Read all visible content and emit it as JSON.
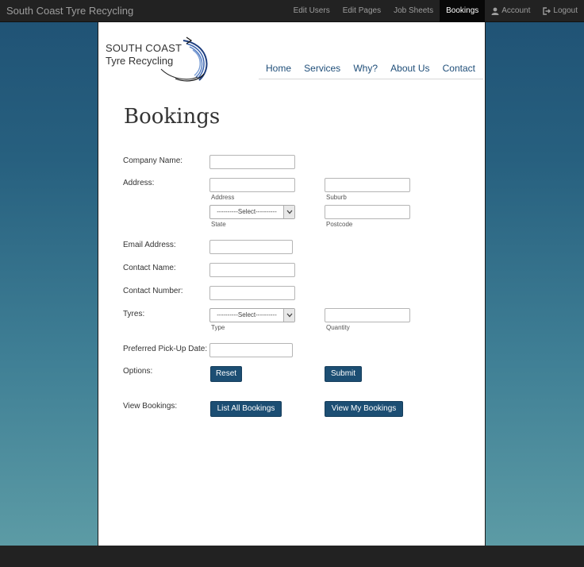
{
  "topbar": {
    "brand": "South Coast Tyre Recycling",
    "links": {
      "edit_users": "Edit Users",
      "edit_pages": "Edit Pages",
      "job_sheets": "Job Sheets",
      "bookings": "Bookings",
      "account": "Account",
      "logout": "Logout"
    },
    "active": "Bookings"
  },
  "logo": {
    "line1": "SOUTH COAST",
    "line2": "Tyre Recycling"
  },
  "nav": {
    "home": "Home",
    "services": "Services",
    "why": "Why?",
    "about": "About Us",
    "contact": "Contact"
  },
  "page": {
    "title": "Bookings"
  },
  "form": {
    "company_name_label": "Company Name:",
    "address_label": "Address:",
    "address_sub": "Address",
    "suburb_sub": "Suburb",
    "state_select": "----------Select----------",
    "state_sub": "State",
    "postcode_sub": "Postcode",
    "email_label": "Email Address:",
    "contact_name_label": "Contact Name:",
    "contact_number_label": "Contact Number:",
    "tyres_label": "Tyres:",
    "tyre_type_select": "----------Select----------",
    "type_sub": "Type",
    "quantity_sub": "Quantity",
    "pickup_date_label": "Preferred Pick-Up Date:",
    "options_label": "Options:",
    "reset_button": "Reset",
    "submit_button": "Submit",
    "view_bookings_label": "View Bookings:",
    "list_all_button": "List All Bookings",
    "view_my_button": "View My Bookings"
  },
  "colors": {
    "topbar_bg": "#222222",
    "button_bg": "#1c4e73",
    "nav_link": "#1f4e79",
    "gradient_top": "#1f5174",
    "gradient_bottom": "#5c9ba5"
  }
}
